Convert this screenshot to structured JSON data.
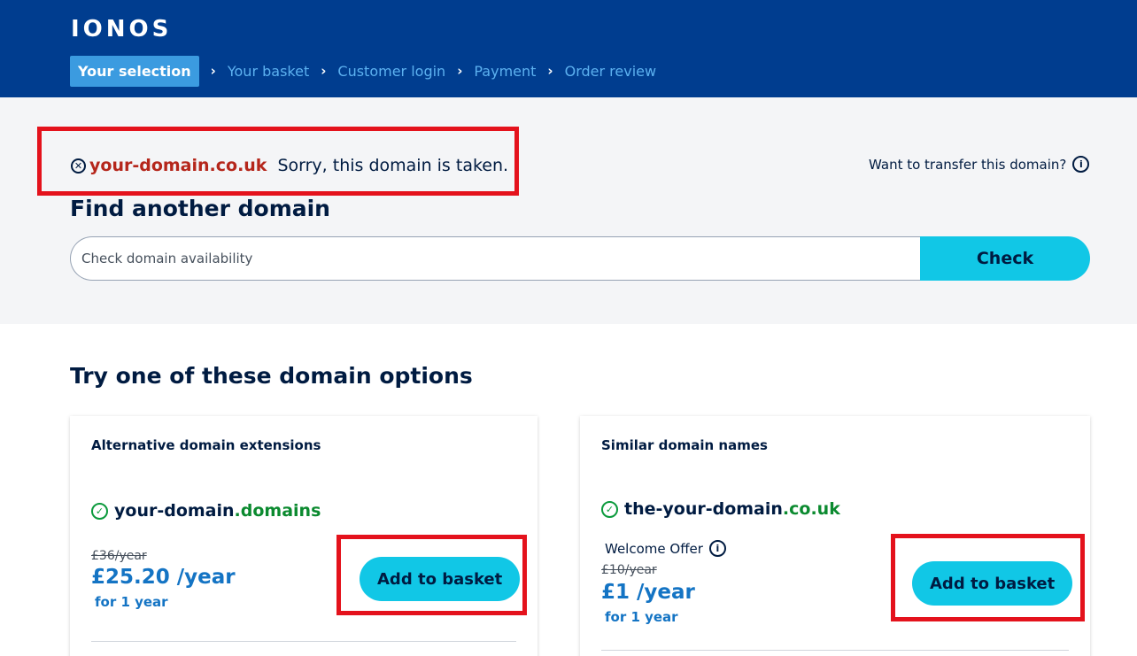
{
  "header": {
    "logo": "IONOS",
    "steps": [
      {
        "label": "Your selection",
        "active": true
      },
      {
        "label": "Your basket",
        "active": false
      },
      {
        "label": "Customer login",
        "active": false
      },
      {
        "label": "Payment",
        "active": false
      },
      {
        "label": "Order review",
        "active": false
      }
    ]
  },
  "search": {
    "taken_domain": "your-domain.co.uk",
    "taken_message": "Sorry, this domain is taken.",
    "transfer_text": "Want to transfer this domain?",
    "find_title": "Find another domain",
    "input_value": "",
    "input_placeholder": "Check domain availability",
    "check_label": "Check"
  },
  "options": {
    "title": "Try one of these domain options",
    "cards": [
      {
        "title": "Alternative domain extensions",
        "domain_name": "your-domain",
        "domain_tld": ".domains",
        "old_price": "£36/year",
        "price": "£25.20 /year",
        "period": "for 1 year",
        "button_label": "Add to basket"
      },
      {
        "title": "Similar domain names",
        "domain_name": "the-your-domain",
        "domain_tld": ".co.uk",
        "welcome": "Welcome Offer",
        "old_price": "£10/year",
        "price": "£1 /year",
        "period": "for 1 year",
        "button_label": "Add to basket"
      }
    ]
  },
  "colors": {
    "header_bg": "#003d8f",
    "active_step": "#3b9be0",
    "button": "#11c7e6",
    "taken_red": "#b5261b",
    "available_green": "#0b8a2f",
    "price_blue": "#1474c4",
    "highlight_red": "#e4121c"
  }
}
